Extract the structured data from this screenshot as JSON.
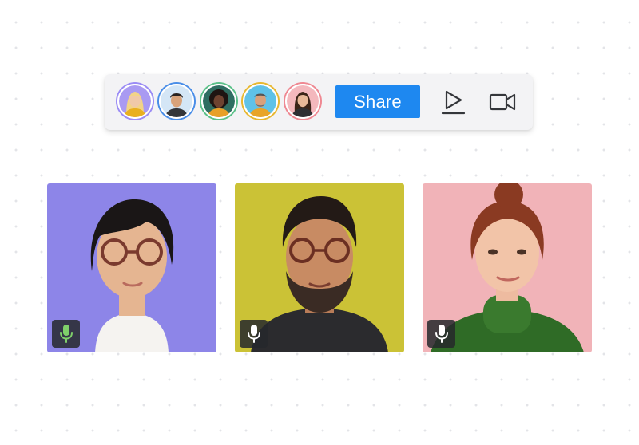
{
  "toolbar": {
    "share_label": "Share",
    "avatars": [
      {
        "name": "avatar-1",
        "ring": "#9b8cf5",
        "bg": "#a99af2",
        "skin": "#f0c9a8",
        "hair": "#f2d486",
        "shirt": "#e9b020"
      },
      {
        "name": "avatar-2",
        "ring": "#4a8ee8",
        "bg": "#d4e6f6",
        "skin": "#d8a27a",
        "hair": "#2a2220",
        "shirt": "#34363a"
      },
      {
        "name": "avatar-3",
        "ring": "#5cc18a",
        "bg": "#2f6e62",
        "skin": "#6e4330",
        "hair": "#1e1512",
        "shirt": "#e8a028"
      },
      {
        "name": "avatar-4",
        "ring": "#e8b830",
        "bg": "#5fc2e8",
        "skin": "#d9a07a",
        "hair": "#555555",
        "shirt": "#e8a428"
      },
      {
        "name": "avatar-5",
        "ring": "#ef8892",
        "bg": "#f4b8bd",
        "skin": "#e8b898",
        "hair": "#3b2418",
        "shirt": "#2f2f33"
      }
    ],
    "icons": [
      "play-icon",
      "video-camera-icon"
    ]
  },
  "participants": [
    {
      "name": "participant-1",
      "bg": "#8d85e8",
      "mic_color": "#7fd06a",
      "mic_icon": "microphone-icon"
    },
    {
      "name": "participant-2",
      "bg": "#cbc236",
      "mic_color": "#ffffff",
      "mic_icon": "microphone-icon"
    },
    {
      "name": "participant-3",
      "bg": "#f1b3b8",
      "mic_color": "#ffffff",
      "mic_icon": "microphone-icon"
    }
  ],
  "colors": {
    "accent": "#1e88f0",
    "toolbar_bg": "#f3f3f5",
    "icon_color": "#34363a"
  }
}
